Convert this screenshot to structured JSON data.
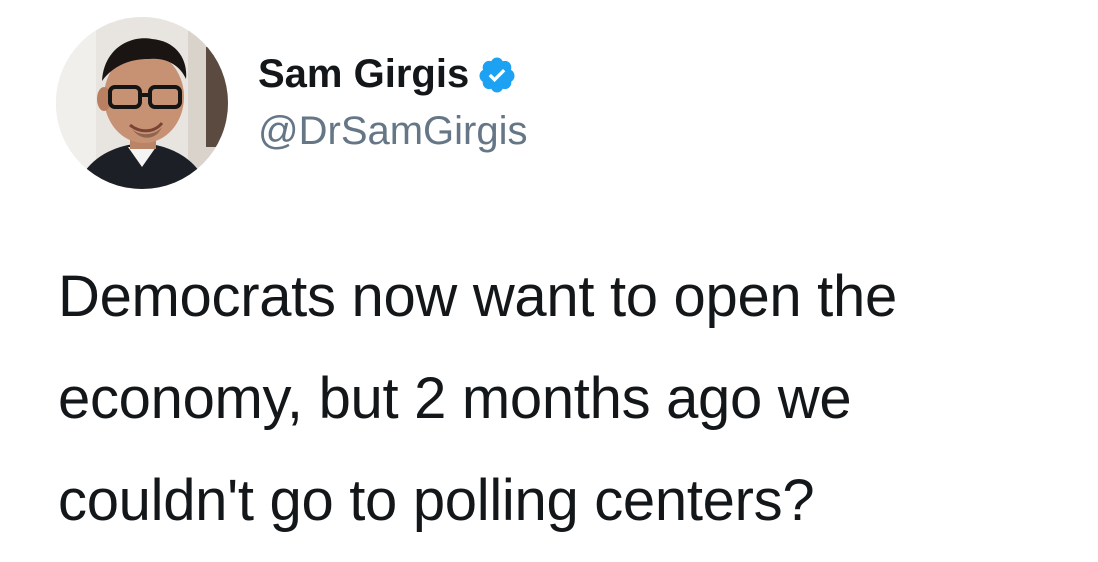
{
  "tweet": {
    "author": {
      "display_name": "Sam Girgis",
      "handle": "@DrSamGirgis",
      "verified": true,
      "avatar": "profile-photo"
    },
    "text_lines": [
      "Democrats now want to open the",
      "economy, but 2 months ago we",
      "couldn't go to polling centers?"
    ]
  },
  "colors": {
    "text": "#14171a",
    "handle": "#657786",
    "verified_badge": "#1da1f2",
    "background": "#ffffff"
  },
  "icons": {
    "verified": "verified-badge-icon"
  }
}
